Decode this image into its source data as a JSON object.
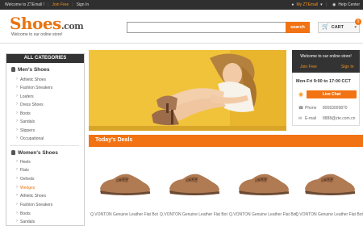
{
  "topbar": {
    "welcome": "Welcome to ZTEmall !",
    "join_free": "Join Free",
    "sign_in": "Sign In",
    "my_account": "My ZTEmall",
    "help_center": "Help Center"
  },
  "header": {
    "logo_main": "Shoes",
    "logo_domain": ".com",
    "tagline": "Welcome to our online store!",
    "search_placeholder": "",
    "search_button": "search",
    "cart_label": "CART",
    "cart_count": "0"
  },
  "categories": {
    "title": "ALL CATEGORIES",
    "groups": [
      {
        "name": "Men's Shoes",
        "items": [
          "Athletic Shoes",
          "Fashion Sneakers",
          "Loafers",
          "Dress Shoes",
          "Boots",
          "Sandals",
          "Slippers",
          "Occupational"
        ]
      },
      {
        "name": "Women's Shoes",
        "items": [
          "Heels",
          "Flats",
          "Oxfords",
          "Wedges",
          "Athletic Shoes",
          "Fashion Sneakers",
          "Boots",
          "Sandals"
        ]
      }
    ],
    "active_item": "Wedges"
  },
  "right_panel": {
    "welcome": "Welcome to our online store!",
    "join_free": "Join Free",
    "sign_in": "Sign In",
    "hours": "Mon-Fri 9:00 to 17:00 CCT",
    "live_chat": "Live Chat",
    "phone_label": "Phone",
    "phone_value": "80083009870",
    "email_label": "E-mail",
    "email_value": "8888@zte.com.cn"
  },
  "deals": {
    "title": "Today's Deals",
    "products": [
      {
        "name": "Q.VONTON Genuine Leather Flat Bottom Women's Flats"
      },
      {
        "name": "Q.VONTON Genuine Leather Flat Bottom Women's Flats"
      },
      {
        "name": "Q.VONTON Genuine Leather Flat Bottom Women's Flats"
      },
      {
        "name": "Q.VONTON Genuine Leather Flat Bottom Women's Flats"
      }
    ]
  },
  "colors": {
    "accent": "#f27313",
    "dark": "#333333",
    "banner_bg": "#f1c33a"
  }
}
